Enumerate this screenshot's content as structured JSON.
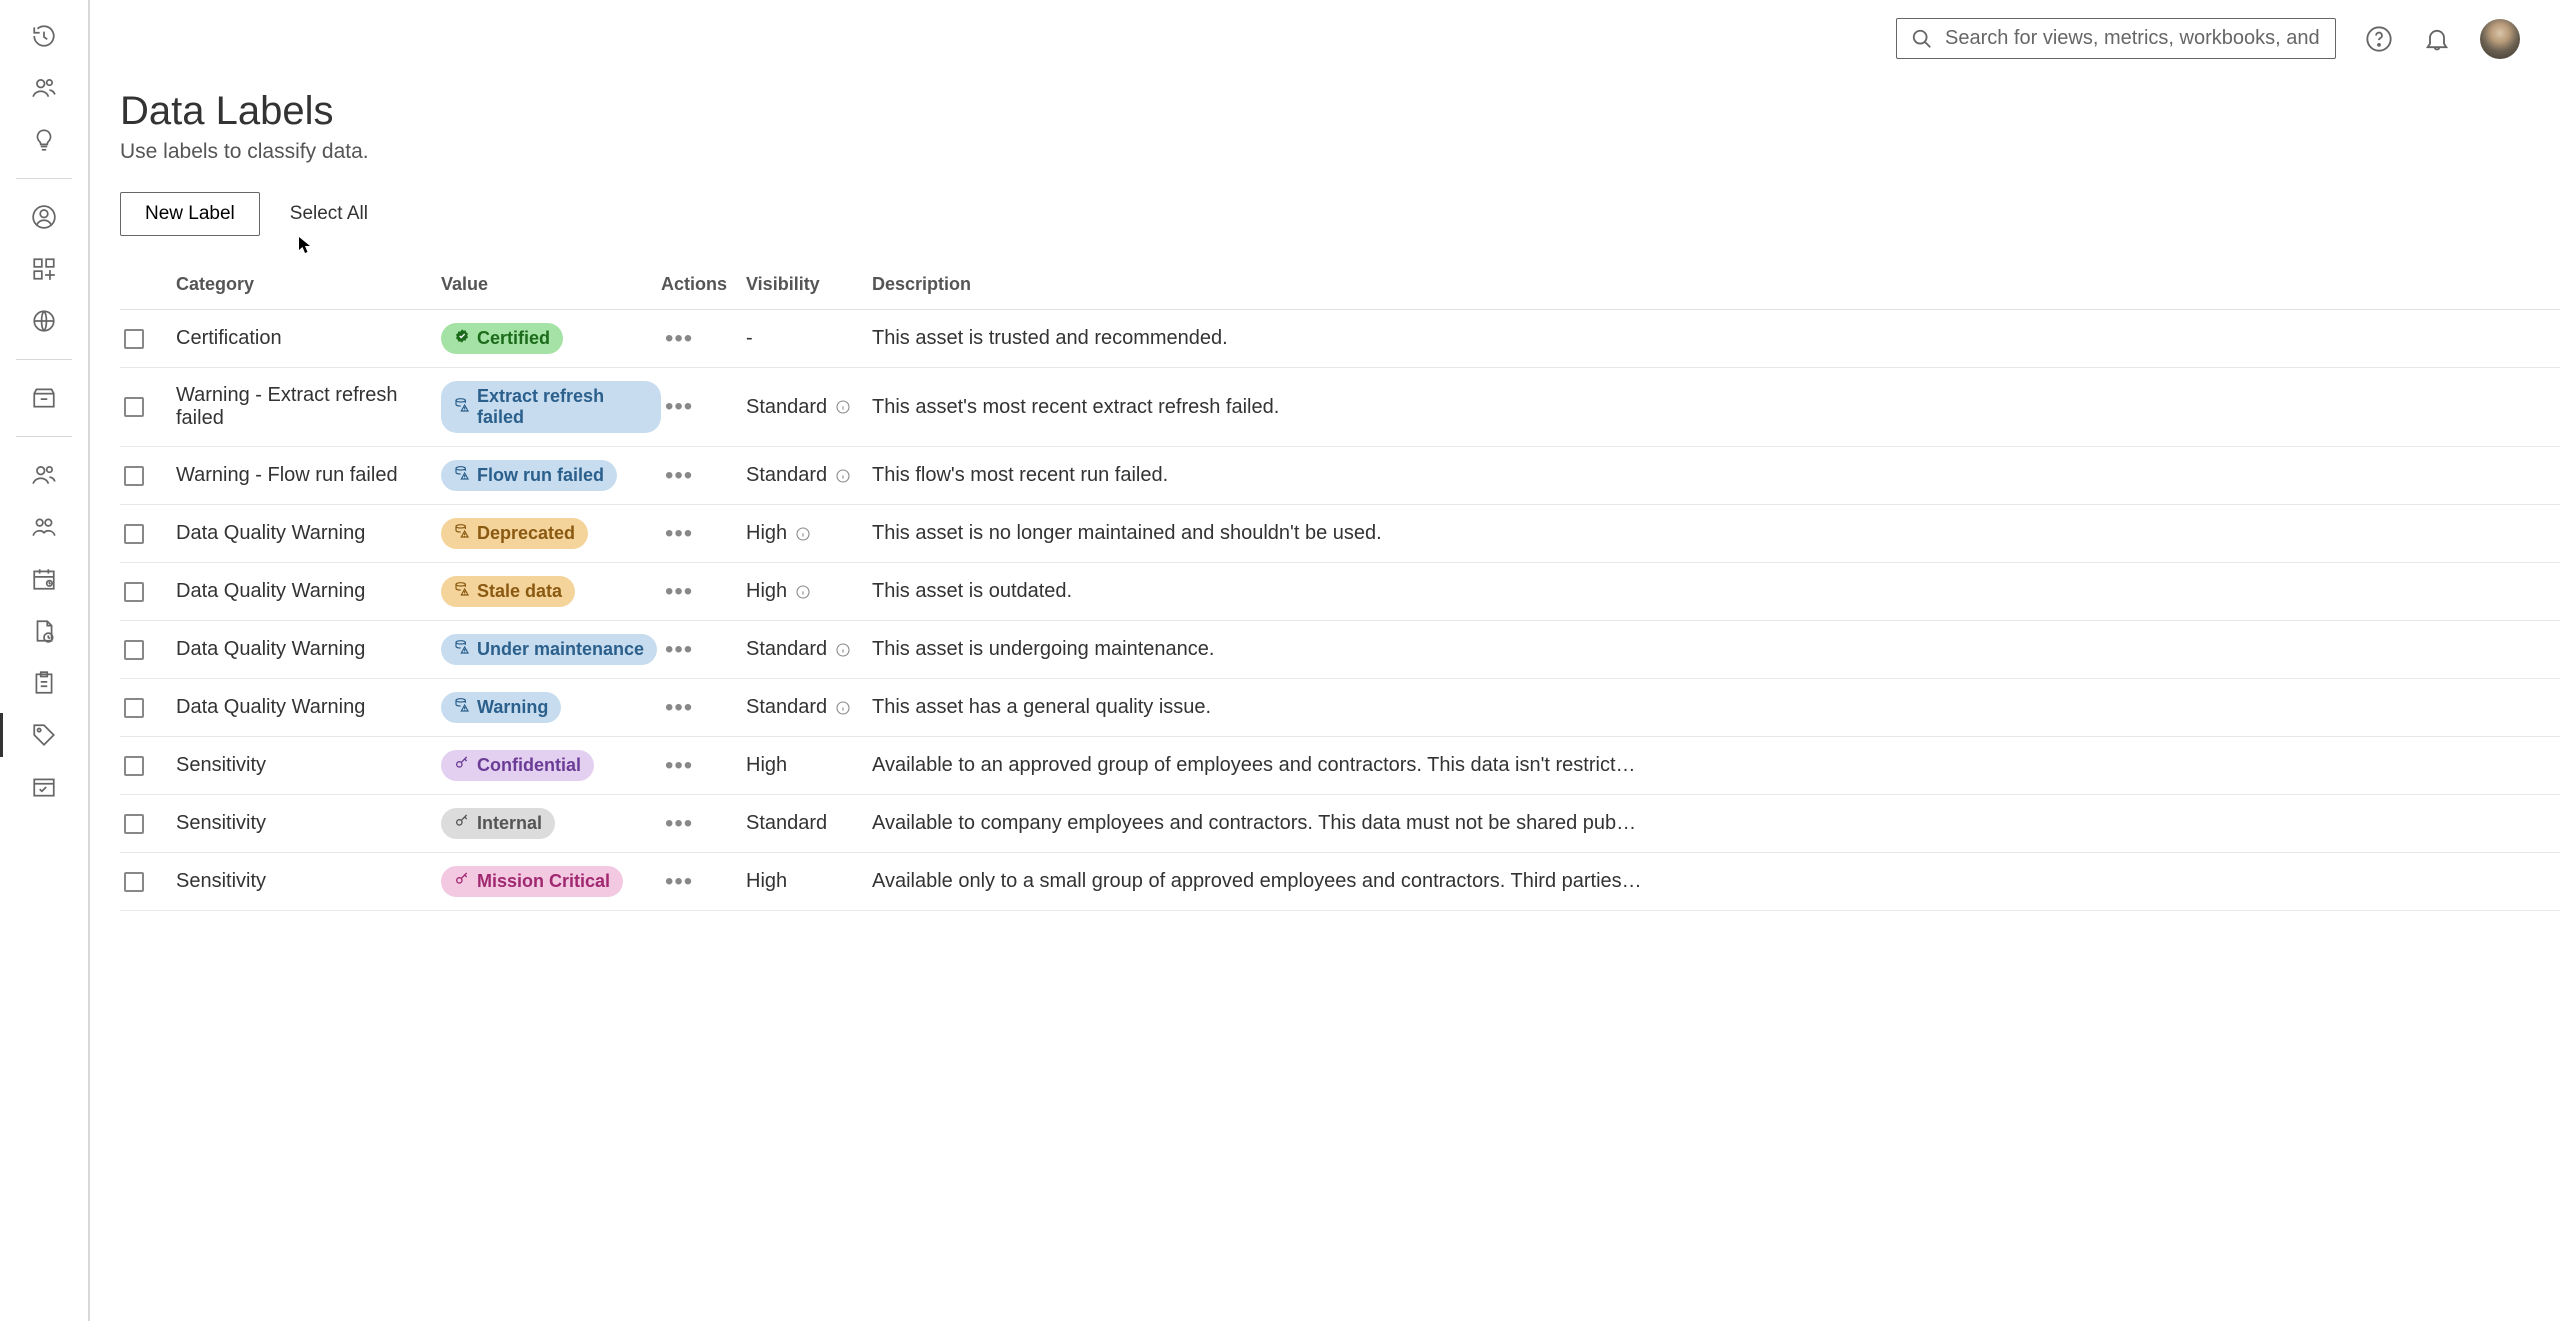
{
  "search": {
    "placeholder": "Search for views, metrics, workbooks, and more"
  },
  "page": {
    "title": "Data Labels",
    "subtitle": "Use labels to classify data.",
    "new_label_btn": "New Label",
    "select_all": "Select All"
  },
  "columns": {
    "category": "Category",
    "value": "Value",
    "actions": "Actions",
    "visibility": "Visibility",
    "description": "Description"
  },
  "badge_styles": {
    "certified": {
      "bg": "#a5e2a5",
      "fg": "#1b6b1b",
      "icon": "certified"
    },
    "blue": {
      "bg": "#c7ddef",
      "fg": "#2b5f8c",
      "icon": "warn-database"
    },
    "orange": {
      "bg": "#f4d49a",
      "fg": "#8a5a12",
      "icon": "warn-database"
    },
    "purple": {
      "bg": "#e3d0f0",
      "fg": "#6b3c96",
      "icon": "key"
    },
    "grey": {
      "bg": "#dcdcdc",
      "fg": "#555555",
      "icon": "key"
    },
    "magenta": {
      "bg": "#f3c9e2",
      "fg": "#a02870",
      "icon": "key"
    }
  },
  "rows": [
    {
      "category": "Certification",
      "badge_style": "certified",
      "value": "Certified",
      "visibility": "-",
      "show_info": false,
      "description": "This asset is trusted and recommended."
    },
    {
      "category": "Warning - Extract refresh failed",
      "badge_style": "blue",
      "value": "Extract refresh failed",
      "visibility": "Standard",
      "show_info": true,
      "description": "This asset's most recent extract refresh failed."
    },
    {
      "category": "Warning - Flow run failed",
      "badge_style": "blue",
      "value": "Flow run failed",
      "visibility": "Standard",
      "show_info": true,
      "description": "This flow's most recent run failed."
    },
    {
      "category": "Data Quality Warning",
      "badge_style": "orange",
      "value": "Deprecated",
      "visibility": "High",
      "show_info": true,
      "description": "This asset is no longer maintained and shouldn't be used."
    },
    {
      "category": "Data Quality Warning",
      "badge_style": "orange",
      "value": "Stale data",
      "visibility": "High",
      "show_info": true,
      "description": "This asset is outdated."
    },
    {
      "category": "Data Quality Warning",
      "badge_style": "blue",
      "value": "Under maintenance",
      "visibility": "Standard",
      "show_info": true,
      "description": "This asset is undergoing maintenance."
    },
    {
      "category": "Data Quality Warning",
      "badge_style": "blue",
      "value": "Warning",
      "visibility": "Standard",
      "show_info": true,
      "description": "This asset has a general quality issue."
    },
    {
      "category": "Sensitivity",
      "badge_style": "purple",
      "value": "Confidential",
      "visibility": "High",
      "show_info": false,
      "description": "Available to an approved group of employees and contractors. This data isn't restrict…"
    },
    {
      "category": "Sensitivity",
      "badge_style": "grey",
      "value": "Internal",
      "visibility": "Standard",
      "show_info": false,
      "description": "Available to company employees and contractors. This data must not be shared pub…"
    },
    {
      "category": "Sensitivity",
      "badge_style": "magenta",
      "value": "Mission Critical",
      "visibility": "High",
      "show_info": false,
      "description": "Available only to a small group of approved employees and contractors. Third parties…"
    }
  ]
}
